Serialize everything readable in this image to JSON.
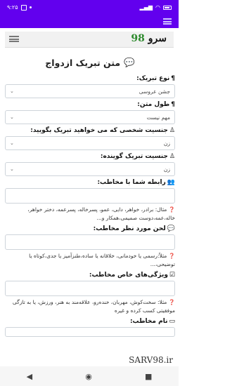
{
  "status": {
    "time": "۹:۲۵"
  },
  "brand": {
    "text": "سرو",
    "number": "98"
  },
  "page": {
    "title": "متن تبریک ازدواج"
  },
  "fields": {
    "type_label": "نوع تبریک:",
    "type_value": "جشن عروسی",
    "length_label": "طول متن:",
    "length_value": "مهم نیست",
    "recipient_gender_label": "جنسیت شخصی که می خواهید تبریک بگویید:",
    "recipient_gender_value": "زن",
    "sender_gender_label": "جنسیت تبریک گوینده:",
    "sender_gender_value": "زن",
    "relation_label": "رابطه شما با مخاطب:",
    "relation_hint": "مثال: برادر، خواهر، دایی، عمو، پسرخاله، پسرعمه، دختر خواهر، خاله،عمه،دوست صمیمی،همکار و...",
    "tone_label": "لحن مورد نظر مخاطب:",
    "tone_hint": "مثلاً:رسمی یا خودمانی، خلاقانه یا ساده،طنزآمیز یا جدی،کوتاه یا توضیحی،...",
    "traits_label": "ویژگی‌های خاص مخاطب:",
    "traits_hint": "مثلا: سخت‌کوش، مهربان، خنده‌رو، علاقه‌مند به هنر، ورزش، یا به تازگی موفقیتی کسب کرده و غیره",
    "name_label": "نام مخاطب:"
  },
  "watermark": "SARV98.ir"
}
